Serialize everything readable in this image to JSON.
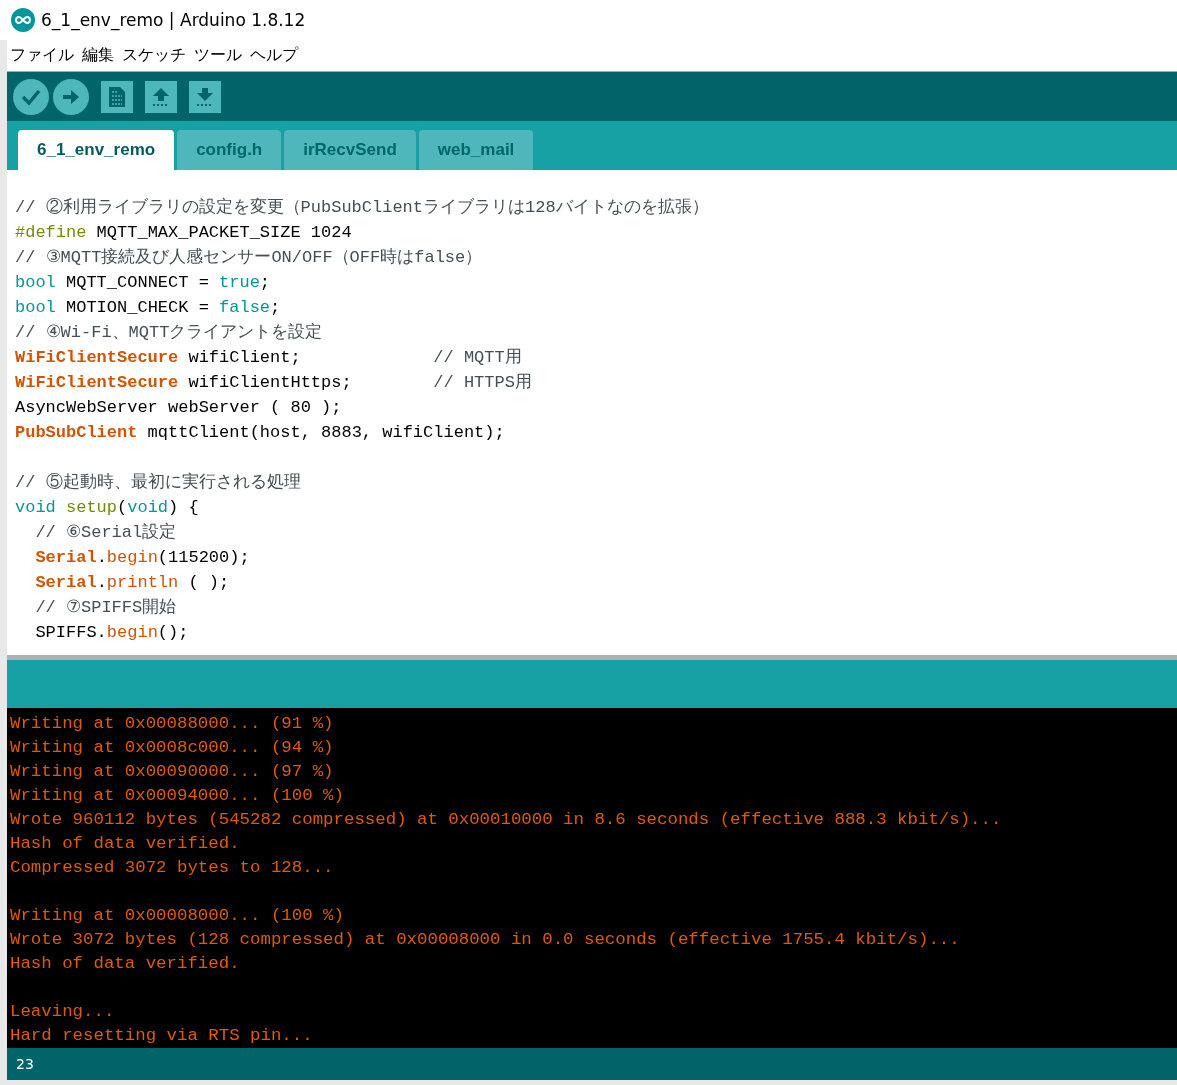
{
  "window": {
    "title": "6_1_env_remo | Arduino 1.8.12"
  },
  "menu": [
    "ファイル",
    "編集",
    "スケッチ",
    "ツール",
    "ヘルプ"
  ],
  "toolbar": [
    {
      "kind": "verify"
    },
    {
      "kind": "upload"
    },
    {
      "kind": "new"
    },
    {
      "kind": "open"
    },
    {
      "kind": "save"
    }
  ],
  "tabs": [
    {
      "label": "6_1_env_remo",
      "selected": true
    },
    {
      "label": "config.h",
      "selected": false
    },
    {
      "label": "irRecvSend",
      "selected": false
    },
    {
      "label": "web_mail",
      "selected": false
    }
  ],
  "editor": {
    "lines": [
      {
        "kind": "code",
        "tokens": [
          {
            "text": "// ②利用ライブラリの設定を変更（PubSubClientライブラリは128バイトなのを拡張）",
            "kind": "comment"
          }
        ]
      },
      {
        "kind": "code",
        "tokens": [
          {
            "text": "#define",
            "kind": "preproc"
          },
          {
            "text": " MQTT_MAX_PACKET_SIZE 1024",
            "kind": "plain"
          }
        ]
      },
      {
        "kind": "code",
        "tokens": [
          {
            "text": "// ③MQTT接続及び人感センサーON/OFF（OFF時はfalse）",
            "kind": "comment"
          }
        ]
      },
      {
        "kind": "code",
        "tokens": [
          {
            "text": "bool",
            "kind": "keyword"
          },
          {
            "text": " MQTT_CONNECT = ",
            "kind": "plain"
          },
          {
            "text": "true",
            "kind": "keyword"
          },
          {
            "text": ";",
            "kind": "plain"
          }
        ]
      },
      {
        "kind": "code",
        "tokens": [
          {
            "text": "bool",
            "kind": "keyword"
          },
          {
            "text": " MOTION_CHECK = ",
            "kind": "plain"
          },
          {
            "text": "false",
            "kind": "keyword"
          },
          {
            "text": ";",
            "kind": "plain"
          }
        ]
      },
      {
        "kind": "code",
        "tokens": [
          {
            "text": "// ④Wi-Fi、MQTTクライアントを設定",
            "kind": "comment"
          }
        ]
      },
      {
        "kind": "code",
        "tokens": [
          {
            "text": "WiFiClientSecure",
            "kind": "type"
          },
          {
            "text": " wifiClient;             ",
            "kind": "plain"
          },
          {
            "text": "// MQTT用",
            "kind": "comment"
          }
        ]
      },
      {
        "kind": "code",
        "tokens": [
          {
            "text": "WiFiClientSecure",
            "kind": "type"
          },
          {
            "text": " wifiClientHttps;        ",
            "kind": "plain"
          },
          {
            "text": "// HTTPS用",
            "kind": "comment"
          }
        ]
      },
      {
        "kind": "code",
        "tokens": [
          {
            "text": "AsyncWebServer webServer ( 80 );",
            "kind": "plain"
          }
        ]
      },
      {
        "kind": "code",
        "tokens": [
          {
            "text": "PubSubClient",
            "kind": "type"
          },
          {
            "text": " mqttClient(host, 8883, wifiClient);",
            "kind": "plain"
          }
        ]
      },
      {
        "kind": "blank"
      },
      {
        "kind": "code",
        "tokens": [
          {
            "text": "// ⑤起動時、最初に実行される処理",
            "kind": "comment"
          }
        ]
      },
      {
        "kind": "code",
        "tokens": [
          {
            "text": "void ",
            "kind": "keyword"
          },
          {
            "text": "setup",
            "kind": "function"
          },
          {
            "text": "(",
            "kind": "plain"
          },
          {
            "text": "void",
            "kind": "keyword"
          },
          {
            "text": ") {",
            "kind": "plain"
          }
        ]
      },
      {
        "kind": "code",
        "tokens": [
          {
            "text": "  // ⑥Serial設定",
            "kind": "comment"
          }
        ]
      },
      {
        "kind": "code",
        "tokens": [
          {
            "text": "  Serial",
            "kind": "type"
          },
          {
            "text": ".",
            "kind": "plain"
          },
          {
            "text": "begin",
            "kind": "method"
          },
          {
            "text": "(115200);",
            "kind": "plain"
          }
        ]
      },
      {
        "kind": "code",
        "tokens": [
          {
            "text": "  Serial",
            "kind": "type"
          },
          {
            "text": ".",
            "kind": "plain"
          },
          {
            "text": "println",
            "kind": "method"
          },
          {
            "text": " ( );",
            "kind": "plain"
          }
        ]
      },
      {
        "kind": "code",
        "tokens": [
          {
            "text": "  // ⑦SPIFFS開始",
            "kind": "comment"
          }
        ]
      },
      {
        "kind": "code",
        "tokens": [
          {
            "text": "  SPIFFS.",
            "kind": "plain"
          },
          {
            "text": "begin",
            "kind": "method"
          },
          {
            "text": "();",
            "kind": "plain"
          }
        ]
      }
    ]
  },
  "console": {
    "lines": [
      {
        "kind": "text",
        "text": "Writing at 0x00088000... (91 %)"
      },
      {
        "kind": "text",
        "text": "Writing at 0x0008c000... (94 %)"
      },
      {
        "kind": "text",
        "text": "Writing at 0x00090000... (97 %)"
      },
      {
        "kind": "text",
        "text": "Writing at 0x00094000... (100 %)"
      },
      {
        "kind": "text",
        "text": "Wrote 960112 bytes (545282 compressed) at 0x00010000 in 8.6 seconds (effective 888.3 kbit/s)..."
      },
      {
        "kind": "text",
        "text": "Hash of data verified."
      },
      {
        "kind": "text",
        "text": "Compressed 3072 bytes to 128..."
      },
      {
        "kind": "blank"
      },
      {
        "kind": "text",
        "text": "Writing at 0x00008000... (100 %)"
      },
      {
        "kind": "text",
        "text": "Wrote 3072 bytes (128 compressed) at 0x00008000 in 0.0 seconds (effective 1755.4 kbit/s)..."
      },
      {
        "kind": "text",
        "text": "Hash of data verified."
      },
      {
        "kind": "blank"
      },
      {
        "kind": "text",
        "text": "Leaving..."
      },
      {
        "kind": "text",
        "text": "Hard resetting via RTS pin..."
      }
    ]
  },
  "status_bar": {
    "line": "23"
  }
}
